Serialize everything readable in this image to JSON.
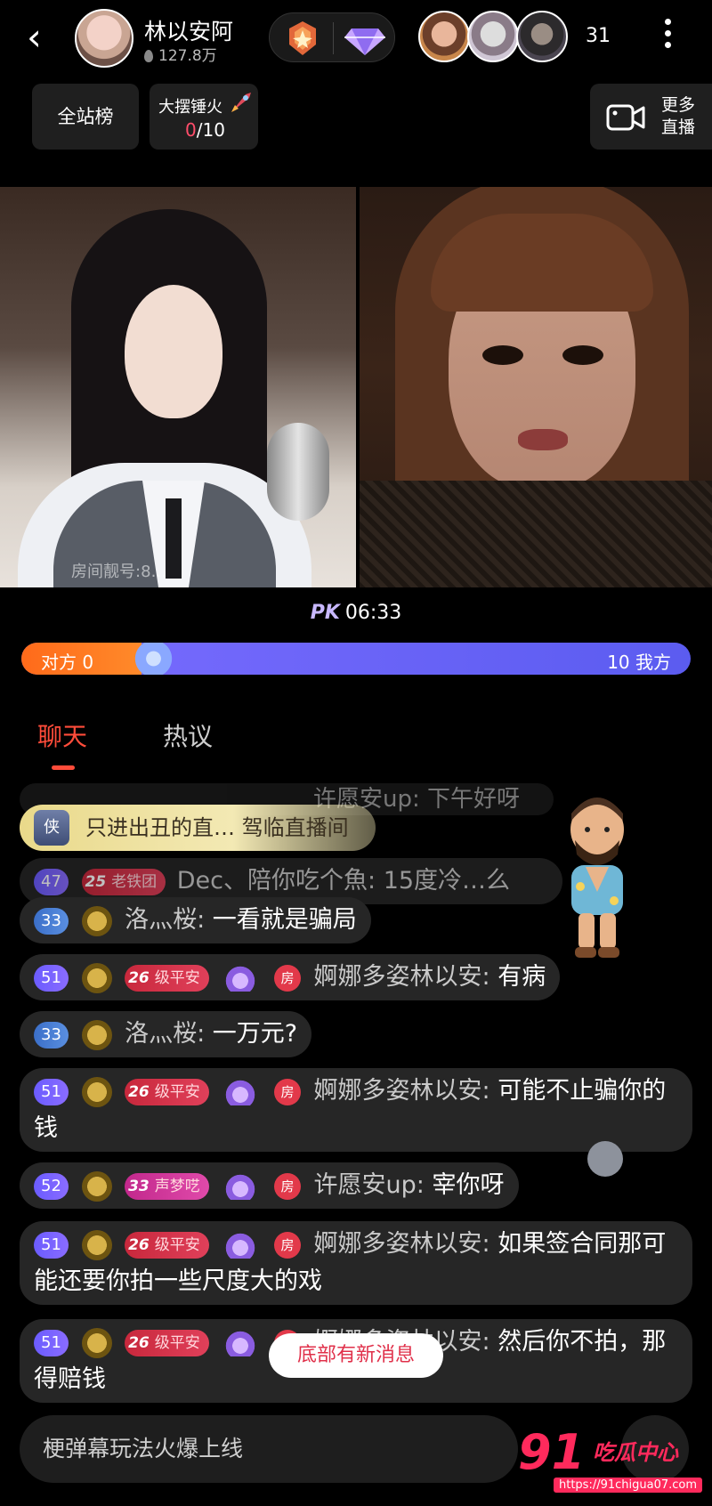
{
  "header": {
    "host_name": "林以安阿",
    "host_fans": "127.8万",
    "viewer_count": "31"
  },
  "subheader": {
    "site_rank_label": "全站榜",
    "hammer_title": "大摆锤火",
    "hammer_current": "0",
    "hammer_total": "/10",
    "more_live_label_1": "更多",
    "more_live_label_2": "直播"
  },
  "video": {
    "left_watermark": "房间靓号:8…"
  },
  "pk": {
    "label": "PK",
    "timer": "06:33",
    "opponent_label": "对方 0",
    "self_label": "10 我方",
    "opponent_share": 0.18
  },
  "tabs": {
    "chat": "聊天",
    "hot": "热议"
  },
  "chat": {
    "faded_top": "许愿安up: 下午好呀",
    "enter_banner": {
      "badge": "侠",
      "text": "只进出丑的直…  驾临直播间"
    },
    "faded_second": "Dec、陪你吃个魚: 15度冷…么",
    "messages": [
      {
        "level": "33",
        "name": "洛灬桜:",
        "text": "一看就是骗局"
      },
      {
        "level": "51",
        "fan_level": "26",
        "fan_name": "级平安",
        "room": "房",
        "name": "婀娜多姿林以安:",
        "text": "有病"
      },
      {
        "level": "33",
        "name": "洛灬桜:",
        "text": "一万元?"
      },
      {
        "level": "51",
        "fan_level": "26",
        "fan_name": "级平安",
        "room": "房",
        "name": "婀娜多姿林以安:",
        "text": "可能不止骗你的钱"
      },
      {
        "level": "52",
        "fan_level": "33",
        "fan_name": "声梦呓",
        "room": "房",
        "name": "许愿安up:",
        "text": "宰你呀"
      },
      {
        "level": "51",
        "fan_level": "26",
        "fan_name": "级平安",
        "room": "房",
        "name": "婀娜多姿林以安:",
        "text": "如果签合同那可能还要你拍一些尺度大的戏"
      },
      {
        "level": "51",
        "fan_level": "26",
        "fan_name": "级平安",
        "room": "房",
        "name": "婀娜多姿林以安:",
        "text": "然后你不拍，那得赔钱"
      }
    ],
    "new_message_hint": "底部有新消息"
  },
  "input": {
    "placeholder": "梗弹幕玩法火爆上线"
  },
  "watermark": {
    "number": "91",
    "text": "吃瓜中心",
    "url": "https://91chigua07.com"
  },
  "colors": {
    "accent": "#ff4c3a",
    "pk_opponent": "#ff7a22",
    "pk_self": "#6b5cff"
  }
}
